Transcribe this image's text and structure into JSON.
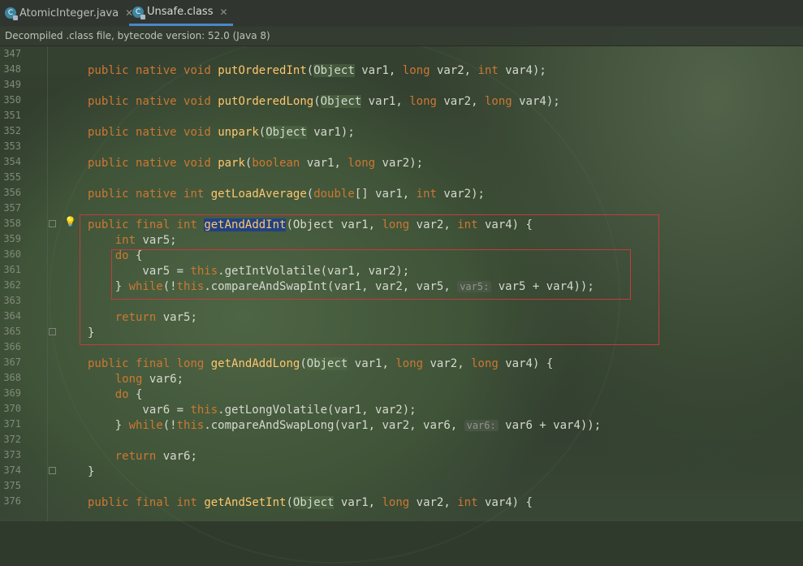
{
  "tabs": [
    {
      "label": "AtomicInteger.java",
      "active": false
    },
    {
      "label": "Unsafe.class",
      "active": true
    }
  ],
  "info_bar": "Decompiled .class file, bytecode version: 52.0 (Java 8)",
  "colors": {
    "keyword": "#cc7832",
    "method": "#ffc66d",
    "annotation_box": "#c43c3c",
    "selection": "#214283",
    "tab_underline": "#4a88c7"
  },
  "line_numbers": [
    "347",
    "348",
    "349",
    "350",
    "351",
    "352",
    "353",
    "354",
    "355",
    "356",
    "357",
    "358",
    "359",
    "360",
    "361",
    "362",
    "363",
    "364",
    "365",
    "366",
    "367",
    "368",
    "369",
    "370",
    "371",
    "372",
    "373",
    "374",
    "375",
    "376"
  ],
  "code": {
    "l348": [
      "public ",
      "native ",
      "void ",
      "putOrderedInt",
      "(",
      "Object",
      " var1, ",
      "long",
      " var2, ",
      "int",
      " var4);"
    ],
    "l350": [
      "public ",
      "native ",
      "void ",
      "putOrderedLong",
      "(",
      "Object",
      " var1, ",
      "long",
      " var2, ",
      "long",
      " var4);"
    ],
    "l352": [
      "public ",
      "native ",
      "void ",
      "unpark",
      "(",
      "Object",
      " var1);"
    ],
    "l354": [
      "public ",
      "native ",
      "void ",
      "park",
      "(",
      "boolean",
      " var1, ",
      "long",
      " var2);"
    ],
    "l356": [
      "public ",
      "native ",
      "int ",
      "getLoadAverage",
      "(",
      "double",
      "[] var1, ",
      "int",
      " var2);"
    ],
    "l358": [
      "public ",
      "final ",
      "int ",
      "getAndAddInt",
      "(",
      "Object",
      " var1, ",
      "long",
      " var2, ",
      "int",
      " var4) {"
    ],
    "l359": [
      "    ",
      "int",
      " var5;"
    ],
    "l360": [
      "    ",
      "do",
      " {"
    ],
    "l361": [
      "        var5 = ",
      "this",
      ".getIntVolatile(var1, var2);"
    ],
    "l362": [
      "    } ",
      "while",
      "(!",
      "this",
      ".compareAndSwapInt(var1, var2, var5, ",
      "var5:",
      " var5 + var4));"
    ],
    "l364": [
      "    ",
      "return",
      " var5;"
    ],
    "l365": [
      "}"
    ],
    "l367": [
      "public ",
      "final ",
      "long ",
      "getAndAddLong",
      "(",
      "Object",
      " var1, ",
      "long",
      " var2, ",
      "long",
      " var4) {"
    ],
    "l368": [
      "    ",
      "long",
      " var6;"
    ],
    "l369": [
      "    ",
      "do",
      " {"
    ],
    "l370": [
      "        var6 = ",
      "this",
      ".getLongVolatile(var1, var2);"
    ],
    "l371": [
      "    } ",
      "while",
      "(!",
      "this",
      ".compareAndSwapLong(var1, var2, var6, ",
      "var6:",
      " var6 + var4));"
    ],
    "l373": [
      "    ",
      "return",
      " var6;"
    ],
    "l374": [
      "}"
    ],
    "l376": [
      "public ",
      "final ",
      "int ",
      "getAndSetInt",
      "(",
      "Object",
      " var1, ",
      "long",
      " var2, ",
      "int",
      " var4) {"
    ]
  }
}
